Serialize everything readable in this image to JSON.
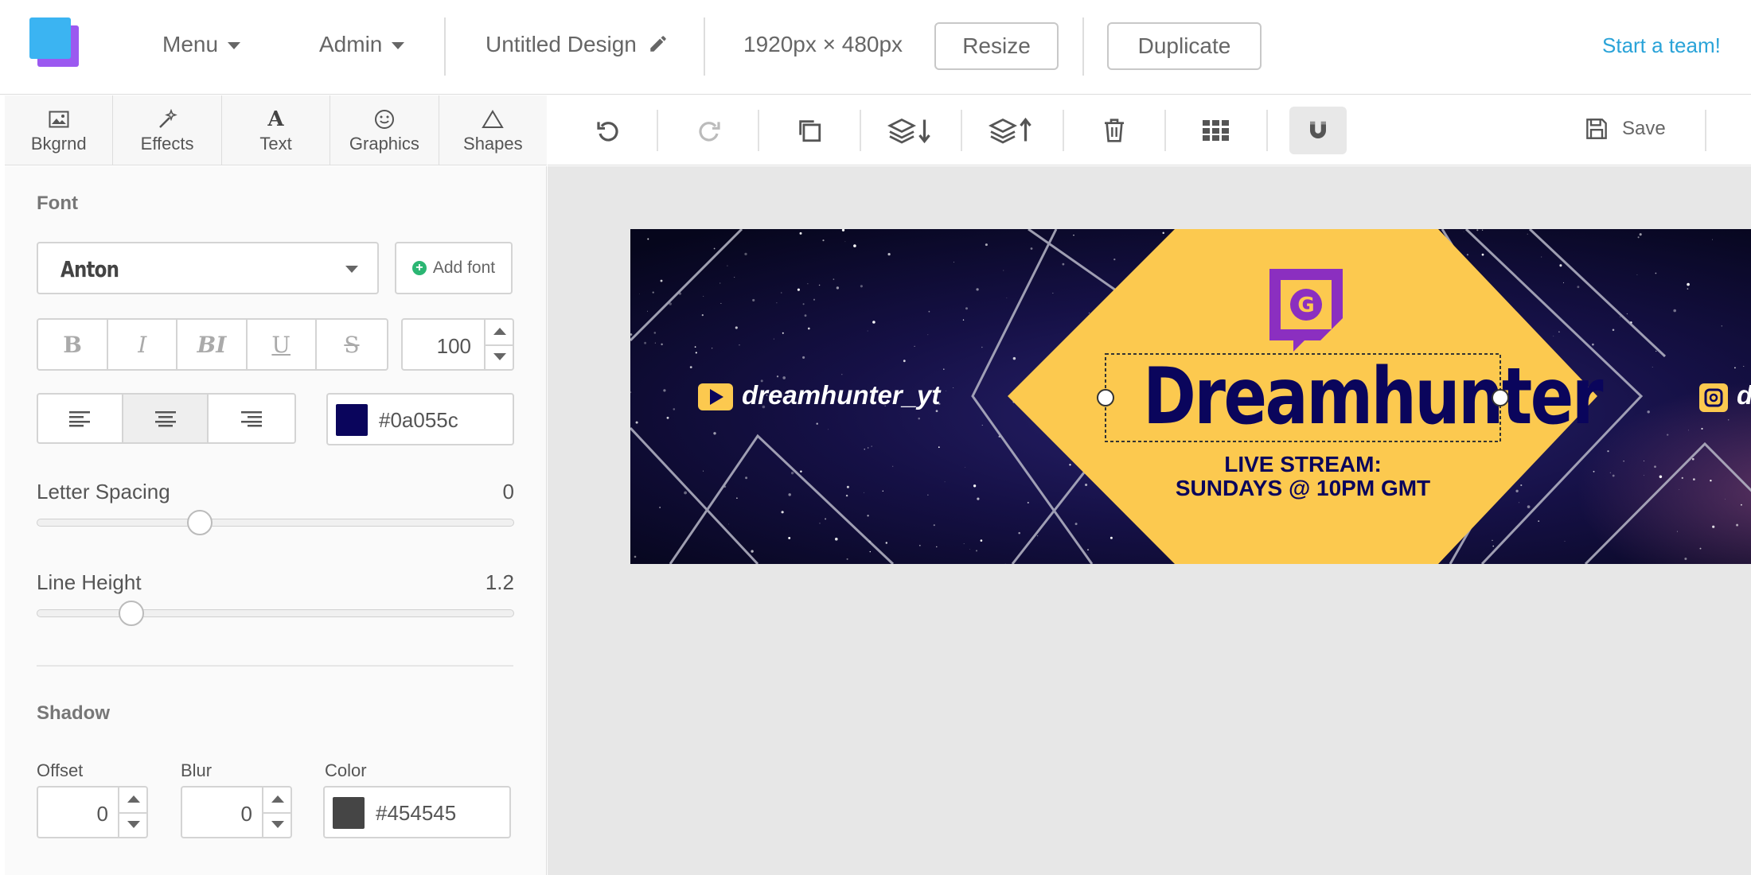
{
  "topbar": {
    "menu_label": "Menu",
    "admin_label": "Admin",
    "design_title": "Untitled Design",
    "dimensions": "1920px × 480px",
    "resize_label": "Resize",
    "duplicate_label": "Duplicate",
    "team_link": "Start a team!"
  },
  "tabs": [
    {
      "label": "Bkgrnd",
      "icon": "image-icon"
    },
    {
      "label": "Effects",
      "icon": "magic-wand-icon"
    },
    {
      "label": "Text",
      "icon": "text-icon"
    },
    {
      "label": "Graphics",
      "icon": "smiley-icon"
    },
    {
      "label": "Shapes",
      "icon": "triangle-icon"
    }
  ],
  "toolbar": {
    "save_label": "Save",
    "tools": [
      "undo-icon",
      "redo-icon",
      "copy-icon",
      "layer-down-icon",
      "layer-up-icon",
      "trash-icon",
      "grid-icon",
      "magnet-icon"
    ]
  },
  "panel": {
    "font_title": "Font",
    "font_name": "Anton",
    "add_font_label": "Add font",
    "style_buttons": [
      "B",
      "I",
      "BI",
      "U",
      "S"
    ],
    "font_size": "100",
    "align_options": [
      "align-left",
      "align-center",
      "align-right"
    ],
    "align_selected": "align-center",
    "text_color_hex": "#0a055c",
    "letter_spacing_label": "Letter Spacing",
    "letter_spacing_value": "0",
    "line_height_label": "Line Height",
    "line_height_value": "1.2",
    "shadow_title": "Shadow",
    "offset_label": "Offset",
    "offset_value": "0",
    "blur_label": "Blur",
    "blur_value": "0",
    "color_label": "Color",
    "shadow_color_hex": "#454545"
  },
  "canvas": {
    "youtube_handle": "dreamhunter_yt",
    "headline": "Dreamhunter",
    "subline_1": "LIVE STREAM:",
    "subline_2": "SUNDAYS @ 10PM GMT",
    "right_handle": "d",
    "colors": {
      "accent": "#fcc94f",
      "text": "#0a055c",
      "twitch": "#8b2fc0",
      "sky": "#0b0b2e"
    }
  }
}
